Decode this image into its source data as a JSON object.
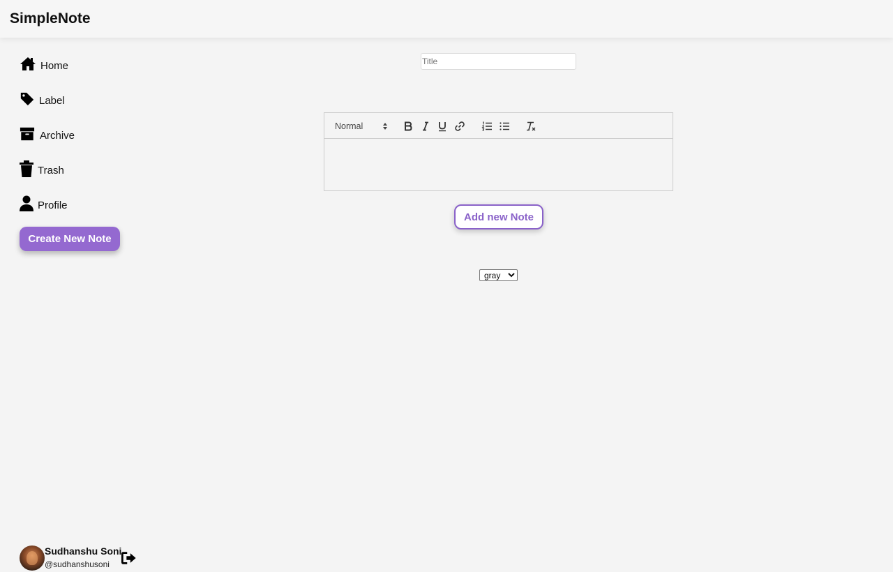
{
  "app": {
    "title": "SimpleNote"
  },
  "sidebar": {
    "items": [
      {
        "label": "Home",
        "icon": "home-icon"
      },
      {
        "label": "Label",
        "icon": "tag-icon"
      },
      {
        "label": "Archive",
        "icon": "archive-icon"
      },
      {
        "label": "Trash",
        "icon": "trash-icon"
      },
      {
        "label": "Profile",
        "icon": "user-icon"
      }
    ],
    "create_label": "Create New Note"
  },
  "user": {
    "name": "Sudhanshu Soni",
    "handle": "@sudhanshusoni",
    "logout_icon": "sign-out-icon"
  },
  "editor": {
    "title_placeholder": "Title",
    "title_value": "",
    "heading_format": "Normal",
    "tools": [
      "bold-icon",
      "italic-icon",
      "underline-icon",
      "link-icon",
      "ordered-list-icon",
      "bullet-list-icon",
      "clear-format-icon"
    ],
    "body": ""
  },
  "add_note_label": "Add new Note",
  "color": {
    "selected": "gray",
    "options": [
      "gray"
    ]
  },
  "colors": {
    "accent": "#9469d0",
    "background": "#f4f4f4"
  }
}
